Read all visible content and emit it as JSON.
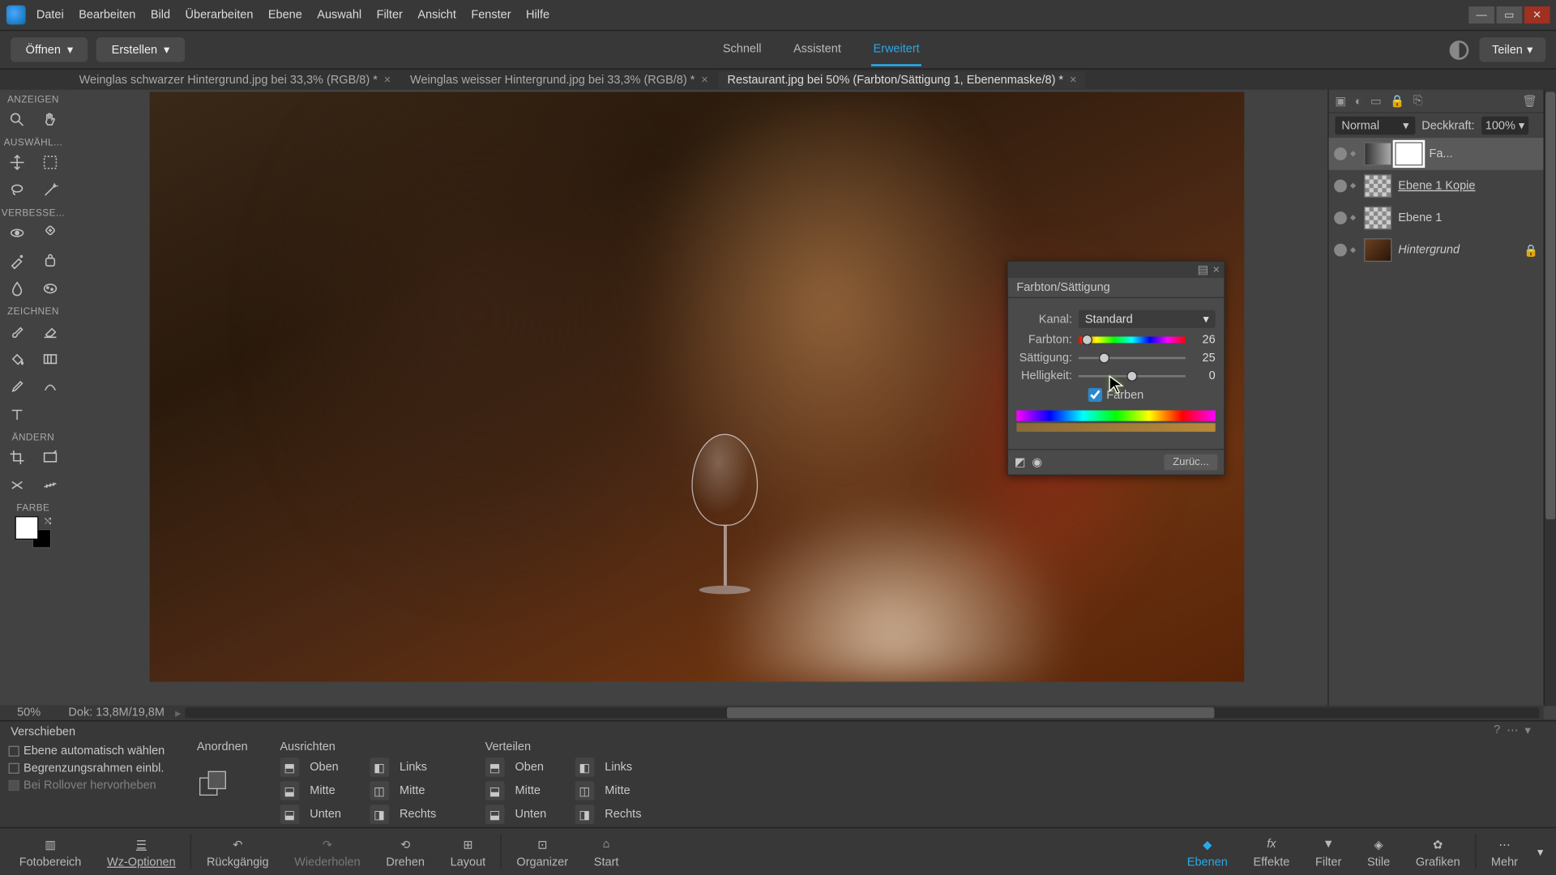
{
  "blend_mode": "Normal",
  "opacity_label": "Deckkraft:",
  "menu": [
    "Datei",
    "Bearbeiten",
    "Bild",
    "Überarbeiten",
    "Ebene",
    "Auswahl",
    "Filter",
    "Ansicht",
    "Fenster",
    "Hilfe"
  ],
  "toolbar": {
    "open": "Öffnen",
    "create": "Erstellen",
    "share": "Teilen"
  },
  "view_tabs": [
    "Schnell",
    "Assistent",
    "Erweitert"
  ],
  "doc_tabs": [
    "Weinglas schwarzer Hintergrund.jpg bei 33,3% (RGB/8) *",
    "Weinglas weisser Hintergrund.jpg bei 33,3% (RGB/8) *",
    "Restaurant.jpg bei 50% (Farbton/Sättigung 1, Ebenenmaske/8) *"
  ],
  "tool_sections": {
    "anzeigen": "ANZEIGEN",
    "auswahl": "AUSWÄHL...",
    "verbesse": "VERBESSE...",
    "zeichnen": "ZEICHNEN",
    "andern": "ÄNDERN",
    "farbe": "FARBE"
  },
  "panel": {
    "title": "Farbton/Sättigung",
    "kanal_label": "Kanal:",
    "kanal_value": "Standard",
    "hue_label": "Farbton:",
    "sat_label": "Sättigung:",
    "light_label": "Helligkeit:",
    "hue": "26",
    "sat": "25",
    "light": "0",
    "colorize": "Färben",
    "reset": "Zurüc..."
  },
  "layers": {
    "opacity": "100%",
    "l0": "Fa...",
    "l1": "Ebene 1 Kopie",
    "l2": "Ebene 1",
    "l3": "Hintergrund"
  },
  "status": {
    "zoom": "50%",
    "doc": "Dok: 13,8M/19,8M"
  },
  "options": {
    "title": "Verschieben",
    "c1": "Ebene automatisch wählen",
    "c2": "Begrenzungsrahmen einbl.",
    "c3": "Bei Rollover hervorheben",
    "anordnen": "Anordnen",
    "ausrichten": "Ausrichten",
    "verteilen": "Verteilen",
    "oben": "Oben",
    "mitte": "Mitte",
    "unten": "Unten",
    "links": "Links",
    "rechts": "Rechts"
  },
  "bottom": {
    "foto": "Fotobereich",
    "wz": "Wz-Optionen",
    "undo": "Rückgängig",
    "redo": "Wiederholen",
    "rotate": "Drehen",
    "layout": "Layout",
    "organizer": "Organizer",
    "start": "Start",
    "ebenen": "Ebenen",
    "effekte": "Effekte",
    "filter": "Filter",
    "stile": "Stile",
    "grafiken": "Grafiken",
    "mehr": "Mehr"
  }
}
